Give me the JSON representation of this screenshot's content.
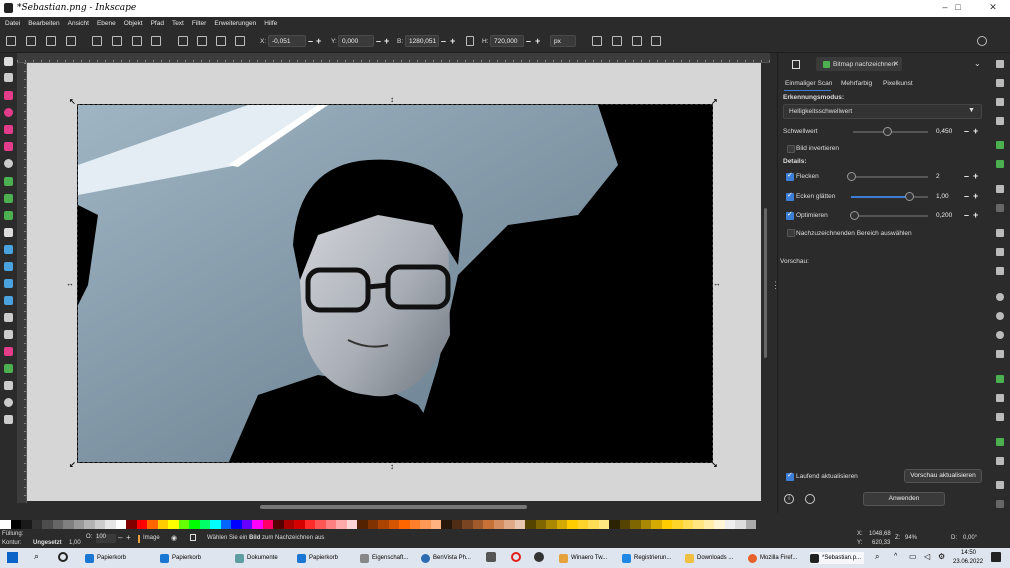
{
  "window": {
    "title": "*Sebastian.png - Inkscape",
    "minimize": "–",
    "maximize": "□",
    "close": "✕"
  },
  "menu": [
    "Datei",
    "Bearbeiten",
    "Ansicht",
    "Ebene",
    "Objekt",
    "Pfad",
    "Text",
    "Filter",
    "Erweiterungen",
    "Hilfe"
  ],
  "toolbar": {
    "x_label": "X:",
    "x_value": "-0,051",
    "y_label": "Y:",
    "y_value": "0,000",
    "w_label": "B:",
    "w_value": "1280,051",
    "h_label": "H:",
    "h_value": "720,000",
    "unit": "px",
    "minus": "–",
    "plus": "+"
  },
  "panel": {
    "dialog_tab": "Bitmap nachzeichnen",
    "tabs": [
      "Einmaliger Scan",
      "Mehrfarbig",
      "Pixelkunst"
    ],
    "detection_label": "Erkennungsmodus:",
    "detection_value": "Helligkeitsschwellwert",
    "threshold_label": "Schwellwert",
    "threshold_value": "0,450",
    "threshold_level": 0.45,
    "invert_label": "Bild invertieren",
    "details_label": "Details:",
    "speckles_label": "Flecken",
    "speckles_value": "2",
    "speckles_level": 0.0,
    "smooth_label": "Ecken glätten",
    "smooth_value": "1,00",
    "smooth_level": 0.75,
    "optimize_label": "Optimieren",
    "optimize_value": "0,200",
    "optimize_level": 0.04,
    "area_label": "Nachzuzeichnenden Bereich auswählen",
    "preview_label": "Vorschau:",
    "live_update_label": "Laufend aktualisieren",
    "update_preview_button": "Vorschau aktualisieren",
    "apply_button": "Anwenden"
  },
  "status": {
    "fill_label": "Füllung:",
    "stroke_label": "Kontur:",
    "stroke_value": "Ungesetzt",
    "stroke_width": "1,00",
    "opacity_label": "O:",
    "opacity_value": "100",
    "layer": "Image",
    "message_prefix": "Wählen Sie ein ",
    "message_bold": "Bild",
    "message_suffix": " zum Nachzeichnen aus",
    "x_label": "X:",
    "x_value": "1048,68",
    "y_label": "Y:",
    "y_value": "620,33",
    "zoom_label": "Z:",
    "zoom_value": "94%",
    "rotation_label": "D:",
    "rotation_value": "0,00°"
  },
  "taskbar": {
    "apps": [
      "Papierkorb",
      "Papierkorb",
      "Dokumente",
      "Papierkorb",
      "Eigenschaft...",
      "BenVista Ph...",
      "Winaero Tw...",
      "Registrierun...",
      "Downloads ...",
      "Mozilla Firef...",
      "*Sebastian.p..."
    ],
    "time": "14:50",
    "date": "23.06.2022"
  },
  "colors": {
    "accent": "#3d7fd6",
    "panel_bg": "#2b2b2b",
    "canvas_bg": "#d6d6d6"
  }
}
